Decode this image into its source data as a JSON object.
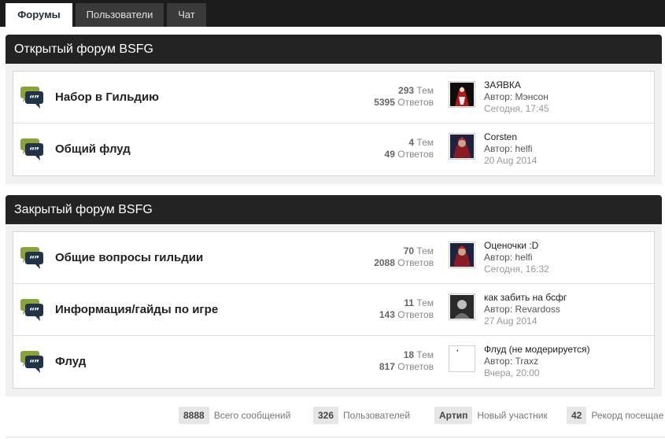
{
  "nav": {
    "tabs": [
      {
        "label": "Форумы"
      },
      {
        "label": "Пользователи"
      },
      {
        "label": "Чат"
      }
    ]
  },
  "categories": [
    {
      "title": "Открытый форум BSFG",
      "forums": [
        {
          "name": "Набор в Гильдию",
          "topics": "293",
          "topics_label": "Тем",
          "posts": "5395",
          "posts_label": "Ответов",
          "last_topic": "ЗАЯВКА",
          "author_label": "Автор:",
          "author": "Мэнсон",
          "date": "Сегодня, 17:45"
        },
        {
          "name": "Общий флуд",
          "topics": "4",
          "topics_label": "Тем",
          "posts": "49",
          "posts_label": "Ответов",
          "last_topic": "Corsten",
          "author_label": "Автор:",
          "author": "helfi",
          "date": "20 Aug 2014"
        }
      ]
    },
    {
      "title": "Закрытый форум BSFG",
      "forums": [
        {
          "name": "Общие вопросы гильдии",
          "topics": "70",
          "topics_label": "Тем",
          "posts": "2088",
          "posts_label": "Ответов",
          "last_topic": "Оценочки :D",
          "author_label": "Автор:",
          "author": "helfi",
          "date": "Сегодня, 16:32"
        },
        {
          "name": "Информация/гайды по игре",
          "topics": "11",
          "topics_label": "Тем",
          "posts": "143",
          "posts_label": "Ответов",
          "last_topic": "как забить на бсфг",
          "author_label": "Автор:",
          "author": "Revardoss",
          "date": "27 Aug 2014"
        },
        {
          "name": "Флуд",
          "topics": "18",
          "topics_label": "Тем",
          "posts": "817",
          "posts_label": "Ответов",
          "last_topic": "Флуд (не модерируется)",
          "author_label": "Автор:",
          "author": "Traxz",
          "date": "Вчера, 20:00"
        }
      ]
    }
  ],
  "footer": {
    "stats": [
      {
        "value": "8888",
        "label": "Всего сообщений"
      },
      {
        "value": "326",
        "label": "Пользователей"
      },
      {
        "value": "Артип",
        "label": "Новый участник"
      },
      {
        "value": "42",
        "label": "Рекорд посещае"
      }
    ]
  },
  "icons": {
    "forum": "speech-bubbles-icon",
    "avatars": [
      "avatar-red-figure",
      "avatar-red-character",
      "avatar-red-character",
      "avatar-bw-portrait",
      "avatar-blank"
    ]
  },
  "colors": {
    "nav_bg": "#1b1b1b",
    "category_header_bg": "#232323",
    "bubble_green": "#8aa23a",
    "bubble_navy": "#223248"
  }
}
